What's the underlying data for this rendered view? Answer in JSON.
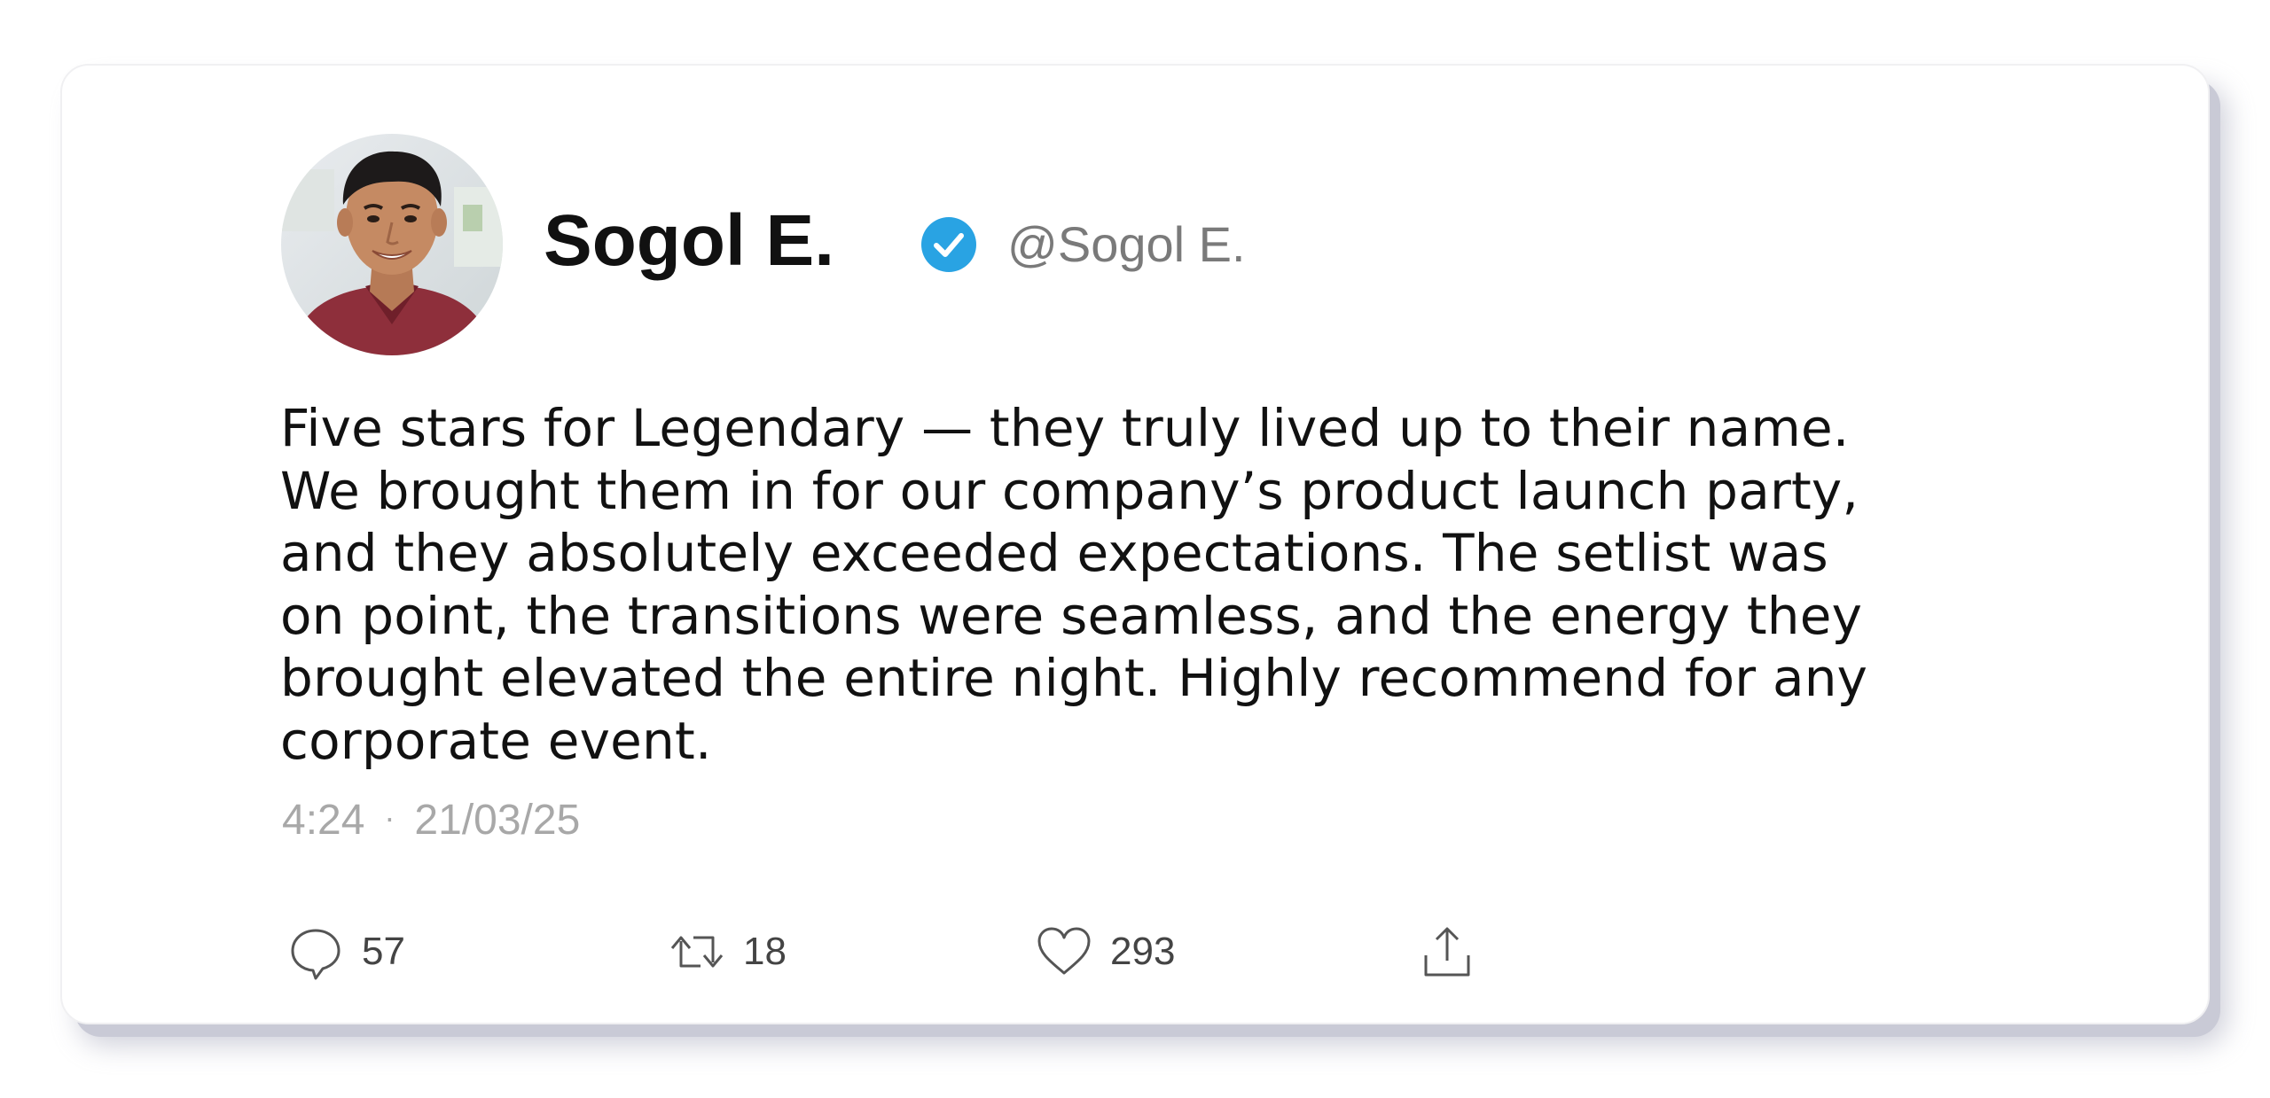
{
  "author": {
    "name": "Sogol E.",
    "handle": "@Sogol E.",
    "verified": true,
    "verified_color": "#1d9bf0"
  },
  "tweet": {
    "lines": [
      "Five stars for Legendary — they truly lived up to their name.",
      "We brought them in for our company’s product launch party,",
      "and they absolutely exceeded expectations. The setlist was",
      "on point, the transitions were seamless, and the energy they",
      "brought elevated the entire night. Highly recommend for any",
      "corporate event."
    ]
  },
  "meta": {
    "time": "4:24",
    "separator": "·",
    "date": "21/03/25"
  },
  "actions": {
    "reply": {
      "icon": "reply-icon",
      "count": "57"
    },
    "retweet": {
      "icon": "retweet-icon",
      "count": "18"
    },
    "like": {
      "icon": "heart-icon",
      "count": "293"
    },
    "share": {
      "icon": "share-icon"
    }
  }
}
